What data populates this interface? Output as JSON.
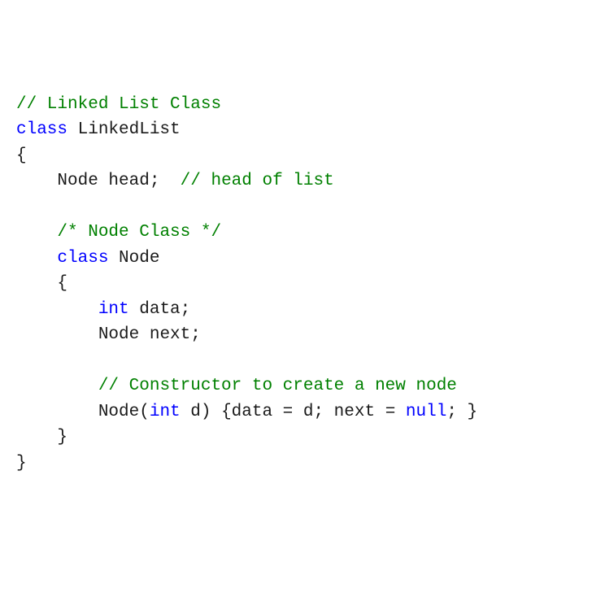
{
  "code": {
    "lines": [
      {
        "indent": 0,
        "tokens": [
          {
            "cls": "comment",
            "text": "// Linked List Class"
          }
        ]
      },
      {
        "indent": 0,
        "tokens": [
          {
            "cls": "keyword",
            "text": "class"
          },
          {
            "cls": "plain",
            "text": " LinkedList"
          }
        ]
      },
      {
        "indent": 0,
        "tokens": [
          {
            "cls": "plain",
            "text": "{"
          }
        ]
      },
      {
        "indent": 1,
        "tokens": [
          {
            "cls": "plain",
            "text": "Node head;  "
          },
          {
            "cls": "comment",
            "text": "// head of list"
          }
        ]
      },
      {
        "indent": 0,
        "tokens": []
      },
      {
        "indent": 1,
        "tokens": [
          {
            "cls": "comment",
            "text": "/* Node Class */"
          }
        ]
      },
      {
        "indent": 1,
        "tokens": [
          {
            "cls": "keyword",
            "text": "class"
          },
          {
            "cls": "plain",
            "text": " Node"
          }
        ]
      },
      {
        "indent": 1,
        "tokens": [
          {
            "cls": "plain",
            "text": "{"
          }
        ]
      },
      {
        "indent": 2,
        "tokens": [
          {
            "cls": "keyword",
            "text": "int"
          },
          {
            "cls": "plain",
            "text": " data;"
          }
        ]
      },
      {
        "indent": 2,
        "tokens": [
          {
            "cls": "plain",
            "text": "Node next;"
          }
        ]
      },
      {
        "indent": 0,
        "tokens": []
      },
      {
        "indent": 2,
        "tokens": [
          {
            "cls": "comment",
            "text": "// Constructor to create a new node"
          }
        ]
      },
      {
        "indent": 2,
        "tokens": [
          {
            "cls": "plain",
            "text": "Node("
          },
          {
            "cls": "keyword",
            "text": "int"
          },
          {
            "cls": "plain",
            "text": " d) {data = d; next = "
          },
          {
            "cls": "keyword",
            "text": "null"
          },
          {
            "cls": "plain",
            "text": "; }"
          }
        ]
      },
      {
        "indent": 1,
        "tokens": [
          {
            "cls": "plain",
            "text": "}"
          }
        ]
      },
      {
        "indent": 0,
        "tokens": [
          {
            "cls": "plain",
            "text": "}"
          }
        ]
      }
    ]
  },
  "indent_unit": "    "
}
